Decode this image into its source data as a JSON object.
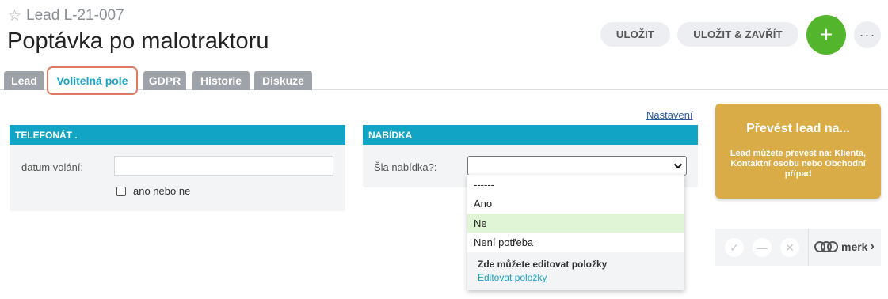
{
  "header": {
    "subtitle": "Lead L-21-007",
    "title": "Poptávka po malotraktoru",
    "save_label": "ULOŽIT",
    "save_close_label": "ULOŽIT & ZAVŘÍT",
    "add_label": "+",
    "more_label": "···"
  },
  "tabs": [
    {
      "label": "Lead"
    },
    {
      "label": "Volitelná pole"
    },
    {
      "label": "GDPR"
    },
    {
      "label": "Historie"
    },
    {
      "label": "Diskuze"
    }
  ],
  "settings_link": "Nastavení",
  "telefonat": {
    "heading": "TELEFONÁT .",
    "date_label": "datum volání:",
    "date_value": "",
    "checkbox_label": "ano nebo ne",
    "checked": false
  },
  "nabidka": {
    "heading": "NABÍDKA",
    "field_label": "Šla nabídka?:",
    "selected": "",
    "options": [
      "------",
      "Ano",
      "Ne",
      "Není potřeba"
    ],
    "highlighted": "Ne",
    "footer_text": "Zde můžete editovat položky",
    "footer_link": "Editovat položky"
  },
  "convert": {
    "title": "Převést lead na...",
    "text": "Lead můžete převést na: Klienta, Kontaktní osobu nebo Obchodní případ"
  },
  "merk": {
    "label": "merk",
    "chevron": "›"
  },
  "icons": {
    "star": "star-icon",
    "chevron_down": "chevron-down-icon",
    "check": "check-icon",
    "minus": "minus-icon",
    "close": "close-icon",
    "merk_logo": "merk-logo-icon"
  },
  "colors": {
    "accent": "#12a4c4",
    "add_button": "#52b52c",
    "convert_card": "#d9ac48",
    "tab_active_outline": "#e07b63",
    "option_highlight": "#dff5d6"
  }
}
